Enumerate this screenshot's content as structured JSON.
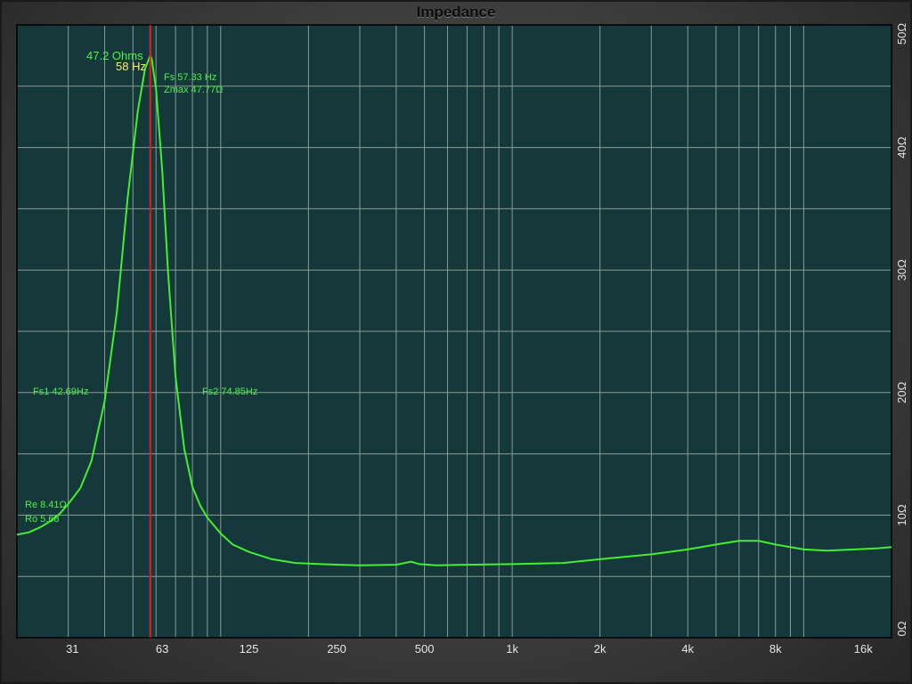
{
  "chart_data": {
    "type": "line",
    "title": "Impedance",
    "x_scale": "log",
    "xlim": [
      20,
      20000
    ],
    "ylim": [
      0,
      50
    ],
    "grid": true,
    "x_ticks": [
      "31",
      "63",
      "125",
      "250",
      "500",
      "1k",
      "2k",
      "4k",
      "8k",
      "16k"
    ],
    "y_ticks": [
      "0Ω",
      "10Ω",
      "20Ω",
      "30Ω",
      "40Ω",
      "50Ω"
    ],
    "colors": {
      "plot_bg": "#15383a",
      "curve": "#44ee30",
      "marker": "#e02020",
      "grid": "#8a9a96"
    },
    "series": [
      {
        "x": [
          20,
          22,
          24,
          26,
          28,
          30,
          33,
          36,
          40,
          44,
          48,
          52,
          55,
          57.33,
          58,
          60,
          63,
          66,
          70,
          75,
          80,
          85,
          90,
          100,
          110,
          125,
          150,
          180,
          220,
          300,
          400,
          450,
          480,
          550,
          700,
          1000,
          1500,
          2000,
          3000,
          4000,
          5000,
          6000,
          7000,
          8000,
          10000,
          12000,
          15000,
          18000,
          20000
        ],
        "y": [
          8.4,
          8.6,
          9.0,
          9.5,
          10.1,
          10.9,
          12.2,
          14.4,
          19.3,
          26.5,
          36.0,
          43.0,
          46.4,
          47.5,
          47.2,
          44.8,
          38.2,
          29.8,
          21.3,
          15.4,
          12.3,
          10.8,
          9.8,
          8.5,
          7.6,
          7.0,
          6.4,
          6.1,
          6.0,
          5.9,
          5.95,
          6.2,
          6.0,
          5.9,
          5.95,
          6.0,
          6.1,
          6.4,
          6.8,
          7.2,
          7.6,
          7.9,
          7.9,
          7.6,
          7.2,
          7.1,
          7.2,
          7.3,
          7.4
        ]
      }
    ],
    "marker": {
      "x": 57.33
    },
    "annotations": {
      "cursor_value": "47.2 Ohms",
      "cursor_freq": "58 Hz",
      "fs": "Fs 57.33 Hz",
      "zmax": "Zmax 47.77Ω",
      "fs1": "Fs1 42.69Hz",
      "fs2": "Fs2 74.85Hz",
      "re": "Re 8.41Ω",
      "ro": "Ro 5.68"
    }
  }
}
